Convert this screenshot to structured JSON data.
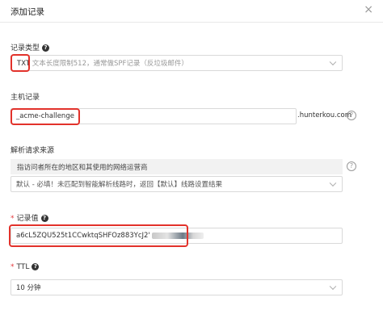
{
  "dialog": {
    "title": "添加记录",
    "close_glyph": "×"
  },
  "record_type": {
    "label": "记录类型",
    "help_glyph": "?",
    "value": "TXT",
    "hint": "文本长度限制512，通常做SPF记录（反垃圾邮件）"
  },
  "host": {
    "label": "主机记录",
    "value": "_acme-challenge",
    "suffix": ".hunterkou.com",
    "help_glyph": "?"
  },
  "resolve_source": {
    "label": "解析请求来源",
    "tip": "指访问者所在的地区和其使用的网络运营商",
    "value": "默认 - 必填！未匹配到智能解析线路时，返回【默认】线路设置结果",
    "help_glyph": "?"
  },
  "record_value": {
    "required_mark": "*",
    "label": "记录值",
    "help_glyph": "?",
    "value": "a6cL5ZQU525t1CCwktqSHFOz883YcJ2'"
  },
  "ttl": {
    "required_mark": "*",
    "label": "TTL",
    "help_glyph": "?",
    "value": "10 分钟"
  },
  "colors": {
    "highlight": "#e2322b",
    "required": "#e4393c",
    "border": "#d9d9d9"
  }
}
